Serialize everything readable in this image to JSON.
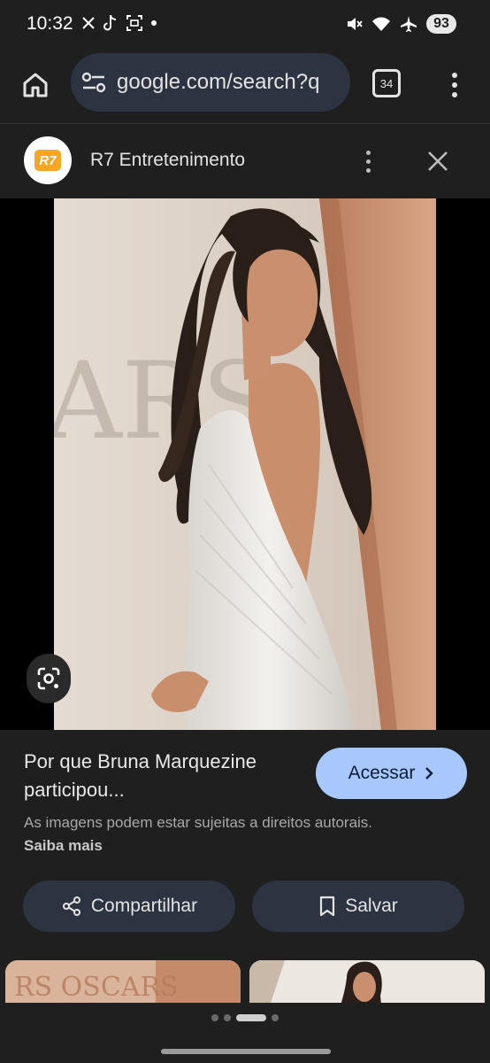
{
  "status_bar": {
    "time": "10:32",
    "battery": "93",
    "left_icons": [
      "x-icon",
      "tiktok-icon",
      "screenshot-icon",
      "dot-icon"
    ],
    "right_icons": [
      "mute-icon",
      "wifi-icon",
      "airplane-icon"
    ]
  },
  "browser": {
    "url": "google.com/search?q",
    "tab_count": "34"
  },
  "source": {
    "logo_text": "R7",
    "name": "R7 Entretenimento"
  },
  "result": {
    "title": "Por que Bruna Marquezine participou...",
    "visit_label": "Acessar",
    "copyright_text": "As imagens podem estar sujeitas a direitos autorais.",
    "learn_more": "Saiba mais",
    "share_label": "Compartilhar",
    "save_label": "Salvar"
  },
  "carousel": {
    "page_count": 4,
    "active_index": 2
  },
  "colors": {
    "background": "#1f1f1f",
    "accent_button": "#a8c7fa",
    "pill_button": "#2d3441"
  }
}
